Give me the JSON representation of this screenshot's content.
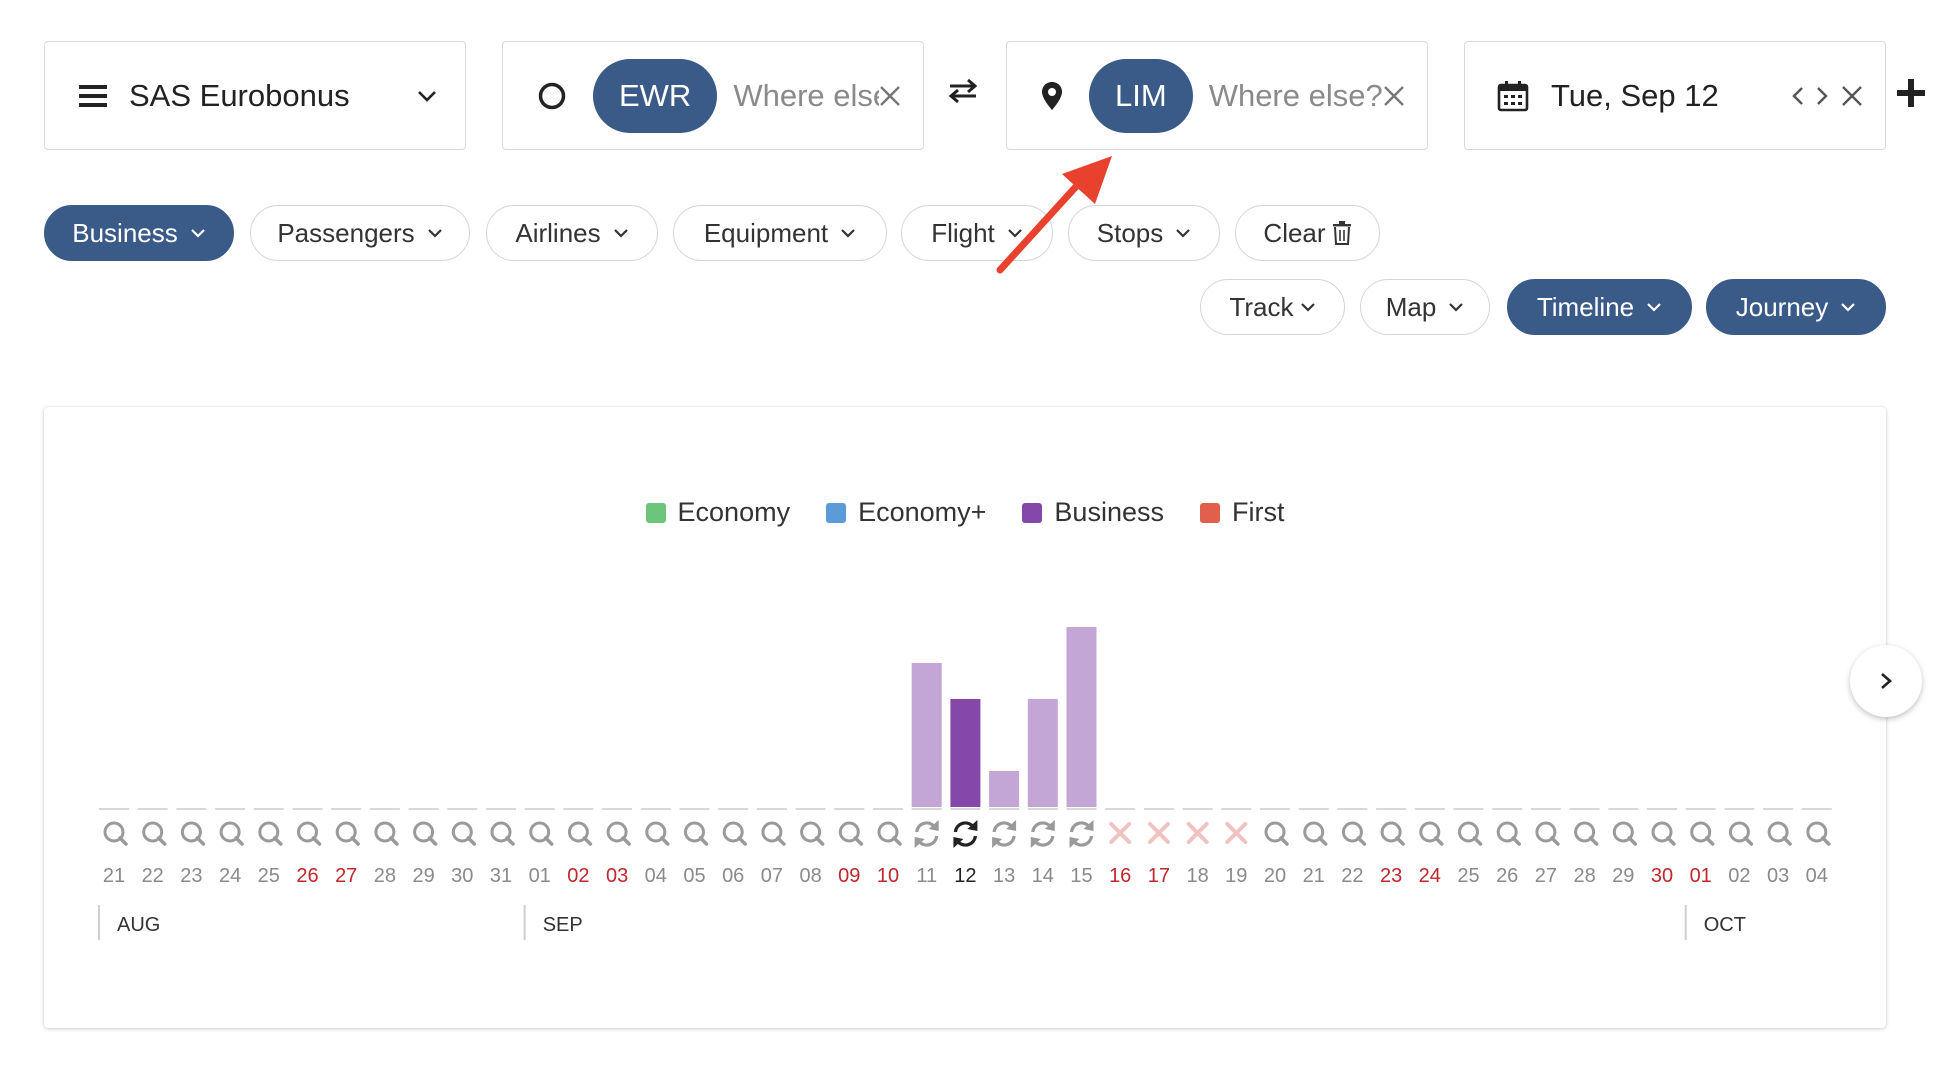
{
  "search": {
    "program": {
      "label": "SAS Eurobonus",
      "icon": "hamburger-menu-icon"
    },
    "origin": {
      "code": "EWR",
      "placeholder": "Where else"
    },
    "destination": {
      "code": "LIM",
      "placeholder": "Where else?"
    },
    "date": {
      "label": "Tue, Sep 12"
    }
  },
  "filters": {
    "row1": [
      "Business",
      "Passengers",
      "Airlines",
      "Equipment",
      "Flight",
      "Stops",
      "Clear"
    ],
    "row2": [
      "Track",
      "Map",
      "Timeline",
      "Journey"
    ],
    "active": [
      "Business",
      "Timeline",
      "Journey"
    ]
  },
  "legend": [
    {
      "label": "Economy",
      "color": "#6cc57a"
    },
    {
      "label": "Economy+",
      "color": "#5a9bd8"
    },
    {
      "label": "Business",
      "color": "#8447aa"
    },
    {
      "label": "First",
      "color": "#e0604d"
    }
  ],
  "colors": {
    "accent": "#3a5a87",
    "business_light": "#c3a6d6",
    "business_selected": "#8447aa",
    "weekend": "#c0262d",
    "unavailable": "#f0c2c2",
    "annotation_arrow": "#e8412e"
  },
  "timeline": {
    "months": [
      "AUG",
      "SEP",
      "OCT"
    ],
    "days": [
      {
        "label": "21",
        "status": "search",
        "weekend": false
      },
      {
        "label": "22",
        "status": "search",
        "weekend": false
      },
      {
        "label": "23",
        "status": "search",
        "weekend": false
      },
      {
        "label": "24",
        "status": "search",
        "weekend": false
      },
      {
        "label": "25",
        "status": "search",
        "weekend": false
      },
      {
        "label": "26",
        "status": "search",
        "weekend": true
      },
      {
        "label": "27",
        "status": "search",
        "weekend": true
      },
      {
        "label": "28",
        "status": "search",
        "weekend": false
      },
      {
        "label": "29",
        "status": "search",
        "weekend": false
      },
      {
        "label": "30",
        "status": "search",
        "weekend": false
      },
      {
        "label": "31",
        "status": "search",
        "weekend": false
      },
      {
        "label": "01",
        "status": "search",
        "weekend": false
      },
      {
        "label": "02",
        "status": "search",
        "weekend": true
      },
      {
        "label": "03",
        "status": "search",
        "weekend": true
      },
      {
        "label": "04",
        "status": "search",
        "weekend": false
      },
      {
        "label": "05",
        "status": "search",
        "weekend": false
      },
      {
        "label": "06",
        "status": "search",
        "weekend": false
      },
      {
        "label": "07",
        "status": "search",
        "weekend": false
      },
      {
        "label": "08",
        "status": "search",
        "weekend": false
      },
      {
        "label": "09",
        "status": "search",
        "weekend": true
      },
      {
        "label": "10",
        "status": "search",
        "weekend": true
      },
      {
        "label": "11",
        "status": "refresh",
        "weekend": false,
        "value": 4
      },
      {
        "label": "12",
        "status": "refresh",
        "weekend": false,
        "value": 3,
        "selected": true
      },
      {
        "label": "13",
        "status": "refresh",
        "weekend": false,
        "value": 1
      },
      {
        "label": "14",
        "status": "refresh",
        "weekend": false,
        "value": 3
      },
      {
        "label": "15",
        "status": "refresh",
        "weekend": false,
        "value": 5
      },
      {
        "label": "16",
        "status": "unavailable",
        "weekend": true
      },
      {
        "label": "17",
        "status": "unavailable",
        "weekend": true
      },
      {
        "label": "18",
        "status": "unavailable",
        "weekend": false
      },
      {
        "label": "19",
        "status": "unavailable",
        "weekend": false
      },
      {
        "label": "20",
        "status": "search",
        "weekend": false
      },
      {
        "label": "21",
        "status": "search",
        "weekend": false
      },
      {
        "label": "22",
        "status": "search",
        "weekend": false
      },
      {
        "label": "23",
        "status": "search",
        "weekend": true
      },
      {
        "label": "24",
        "status": "search",
        "weekend": true
      },
      {
        "label": "25",
        "status": "search",
        "weekend": false
      },
      {
        "label": "26",
        "status": "search",
        "weekend": false
      },
      {
        "label": "27",
        "status": "search",
        "weekend": false
      },
      {
        "label": "28",
        "status": "search",
        "weekend": false
      },
      {
        "label": "29",
        "status": "search",
        "weekend": false
      },
      {
        "label": "30",
        "status": "search",
        "weekend": true
      },
      {
        "label": "01",
        "status": "search",
        "weekend": true
      },
      {
        "label": "02",
        "status": "search",
        "weekend": false
      },
      {
        "label": "03",
        "status": "search",
        "weekend": false
      },
      {
        "label": "04",
        "status": "search",
        "weekend": false
      }
    ]
  }
}
